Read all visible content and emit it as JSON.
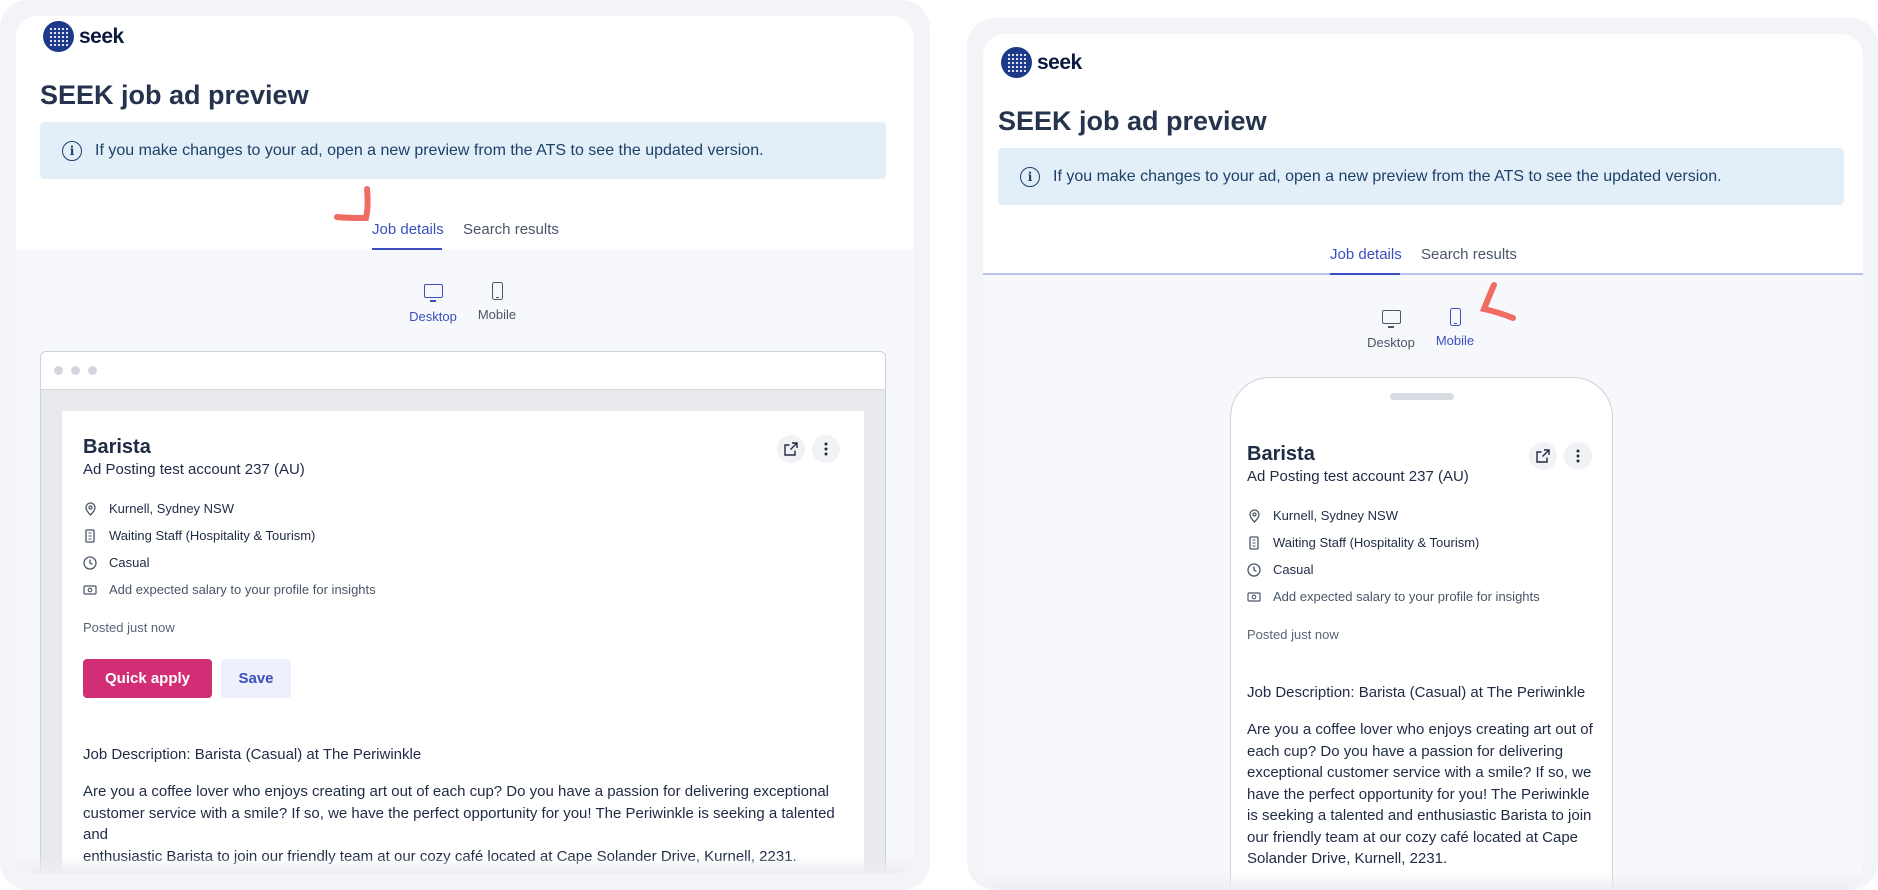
{
  "brand": {
    "logo_text": "seek"
  },
  "page": {
    "title": "SEEK job ad preview"
  },
  "banner": {
    "text": "If you make changes to your ad, open a new preview from the ATS to see the updated version."
  },
  "tabs": [
    {
      "label": "Job details"
    },
    {
      "label": "Search results"
    }
  ],
  "devices": [
    {
      "label": "Desktop"
    },
    {
      "label": "Mobile"
    }
  ],
  "views": [
    {
      "active_tab": "Job details",
      "active_device": "Desktop"
    },
    {
      "active_tab": "Job details",
      "active_device": "Mobile"
    }
  ],
  "job": {
    "title": "Barista",
    "company": "Ad Posting test account 237 (AU)",
    "location": "Kurnell, Sydney NSW",
    "category": "Waiting Staff (Hospitality & Tourism)",
    "work_type": "Casual",
    "salary_hint": "Add expected salary to your profile for insights",
    "posted": "Posted just now",
    "quick_apply_label": "Quick apply",
    "save_label": "Save",
    "description_heading": "Job Description: Barista (Casual) at The Periwinkle",
    "description_desktop_lines": [
      "Are you a coffee lover who enjoys creating art out of each cup? Do you have a passion for delivering exceptional",
      "customer service with a smile? If so, we have the perfect opportunity for you! The Periwinkle is seeking a talented and",
      "enthusiastic Barista to join our friendly team at our cozy café located at Cape Solander Drive, Kurnell, 2231."
    ],
    "description_mobile_lines": [
      "Are you a coffee lover who enjoys creating art out of",
      "each cup? Do you have a passion for delivering",
      "exceptional customer service with a smile? If so, we",
      "have the perfect opportunity for you! The Periwinkle",
      "is seeking a talented and enthusiastic Barista to join",
      "our friendly team at our cozy café located at Cape",
      "Solander Drive, Kurnell, 2231."
    ]
  },
  "icons": {
    "info": "info-icon",
    "location": "location-pin-icon",
    "category": "building-icon",
    "work_type": "clock-icon",
    "salary": "money-icon",
    "share": "external-link-icon",
    "more": "more-vertical-icon",
    "desktop": "desktop-icon",
    "mobile": "mobile-icon"
  },
  "colors": {
    "accent": "#3b4fbf",
    "apply": "#d22e76",
    "banner_bg": "#e3eff8",
    "annotation": "#f06c63"
  }
}
